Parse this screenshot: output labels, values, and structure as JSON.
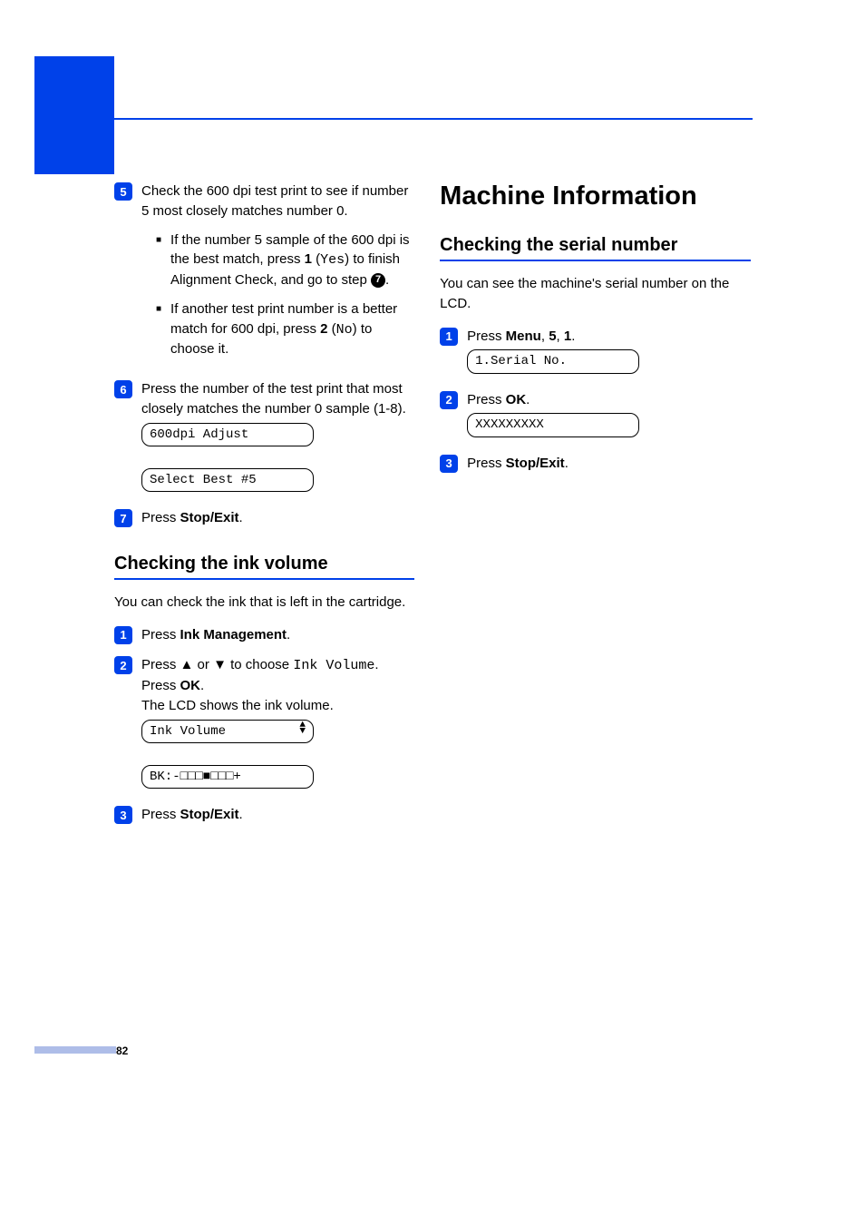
{
  "left": {
    "step5": {
      "text": "Check the 600 dpi test print to see if number 5 most closely matches number 0.",
      "b1_a": "If the number 5 sample of the 600 dpi is the best match, press ",
      "b1_key": "1",
      "b1_b": " (",
      "b1_yes": "Yes",
      "b1_c": ") to finish Alignment Check, and go to step ",
      "b1_ref": "7",
      "b1_d": ".",
      "b2_a": "If another test print number is a better match for 600 dpi, press ",
      "b2_key": "2",
      "b2_b": " (",
      "b2_no": "No",
      "b2_c": ") to choose it."
    },
    "step6": {
      "text": "Press the number of the test print that most closely matches the number 0 sample (1-8).",
      "lcd1": "600dpi Adjust",
      "lcd2": "Select Best #5"
    },
    "step7": {
      "a": "Press ",
      "b": "Stop/Exit",
      "c": "."
    },
    "ink_heading": "Checking the ink volume",
    "ink_intro": "You can check the ink that is left in the cartridge.",
    "ink_s1_a": "Press ",
    "ink_s1_b": "Ink Management",
    "ink_s1_c": ".",
    "ink_s2_a": "Press ",
    "ink_s2_up": "▲",
    "ink_s2_b": " or ",
    "ink_s2_down": "▼",
    "ink_s2_c": " to choose ",
    "ink_s2_mono": "Ink Volume",
    "ink_s2_d": ". Press ",
    "ink_s2_ok": "OK",
    "ink_s2_e": ".",
    "ink_s2_f": "The LCD shows the ink volume.",
    "ink_lcd1": "Ink Volume",
    "ink_lcd2": "BK:-□□□■□□□+",
    "ink_s3_a": "Press ",
    "ink_s3_b": "Stop/Exit",
    "ink_s3_c": "."
  },
  "right": {
    "main_h": "Machine Information",
    "sub_h": "Checking the serial number",
    "intro": "You can see the machine's serial number on the LCD.",
    "s1_a": "Press ",
    "s1_b": "Menu",
    "s1_c": ", ",
    "s1_d": "5",
    "s1_e": ", ",
    "s1_f": "1",
    "s1_g": ".",
    "lcd1": "1.Serial No.",
    "s2_a": "Press ",
    "s2_b": "OK",
    "s2_c": ".",
    "lcd2": "XXXXXXXXX",
    "s3_a": "Press ",
    "s3_b": "Stop/Exit",
    "s3_c": "."
  },
  "page_number": "82"
}
